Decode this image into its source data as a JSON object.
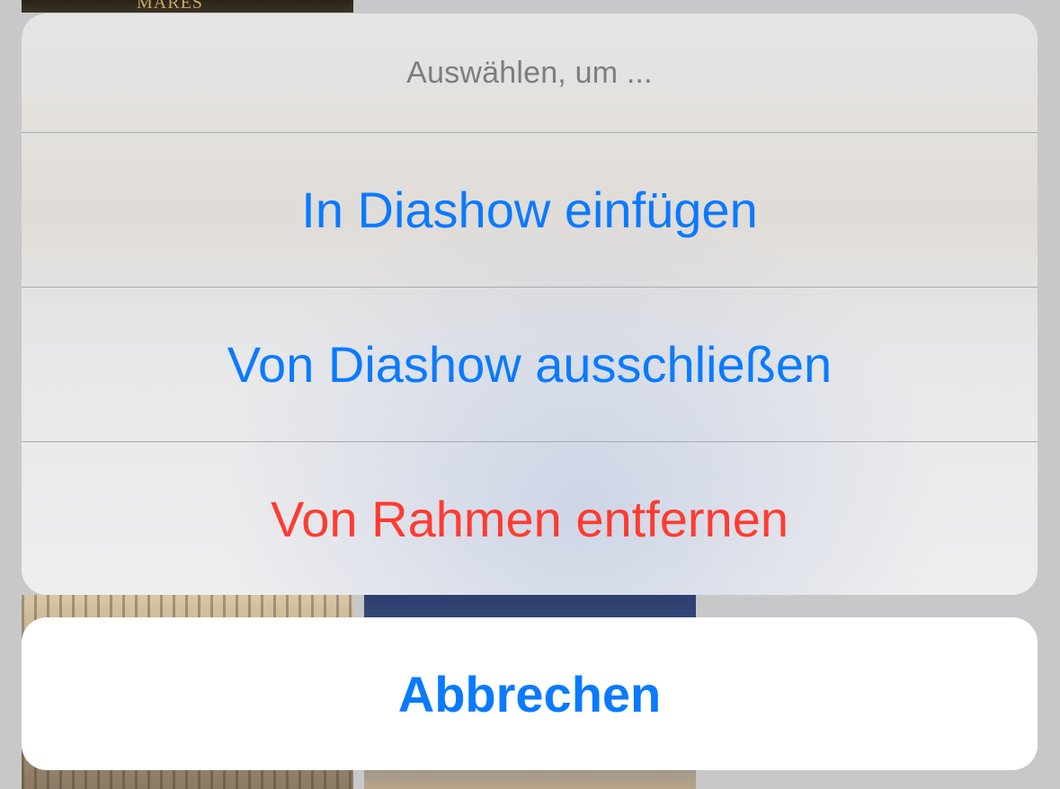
{
  "action_sheet": {
    "title": "Auswählen, um ...",
    "actions": [
      {
        "label": "In Diashow einfügen",
        "style": "default"
      },
      {
        "label": "Von Diashow ausschließen",
        "style": "default"
      },
      {
        "label": "Von Rahmen entfernen",
        "style": "destructive"
      }
    ],
    "cancel_label": "Abbrechen"
  },
  "background": {
    "thumbnail_caption": "MARES"
  },
  "colors": {
    "accent": "#0a7aff",
    "destructive": "#ff3b30",
    "title_gray": "#7d7d80"
  }
}
